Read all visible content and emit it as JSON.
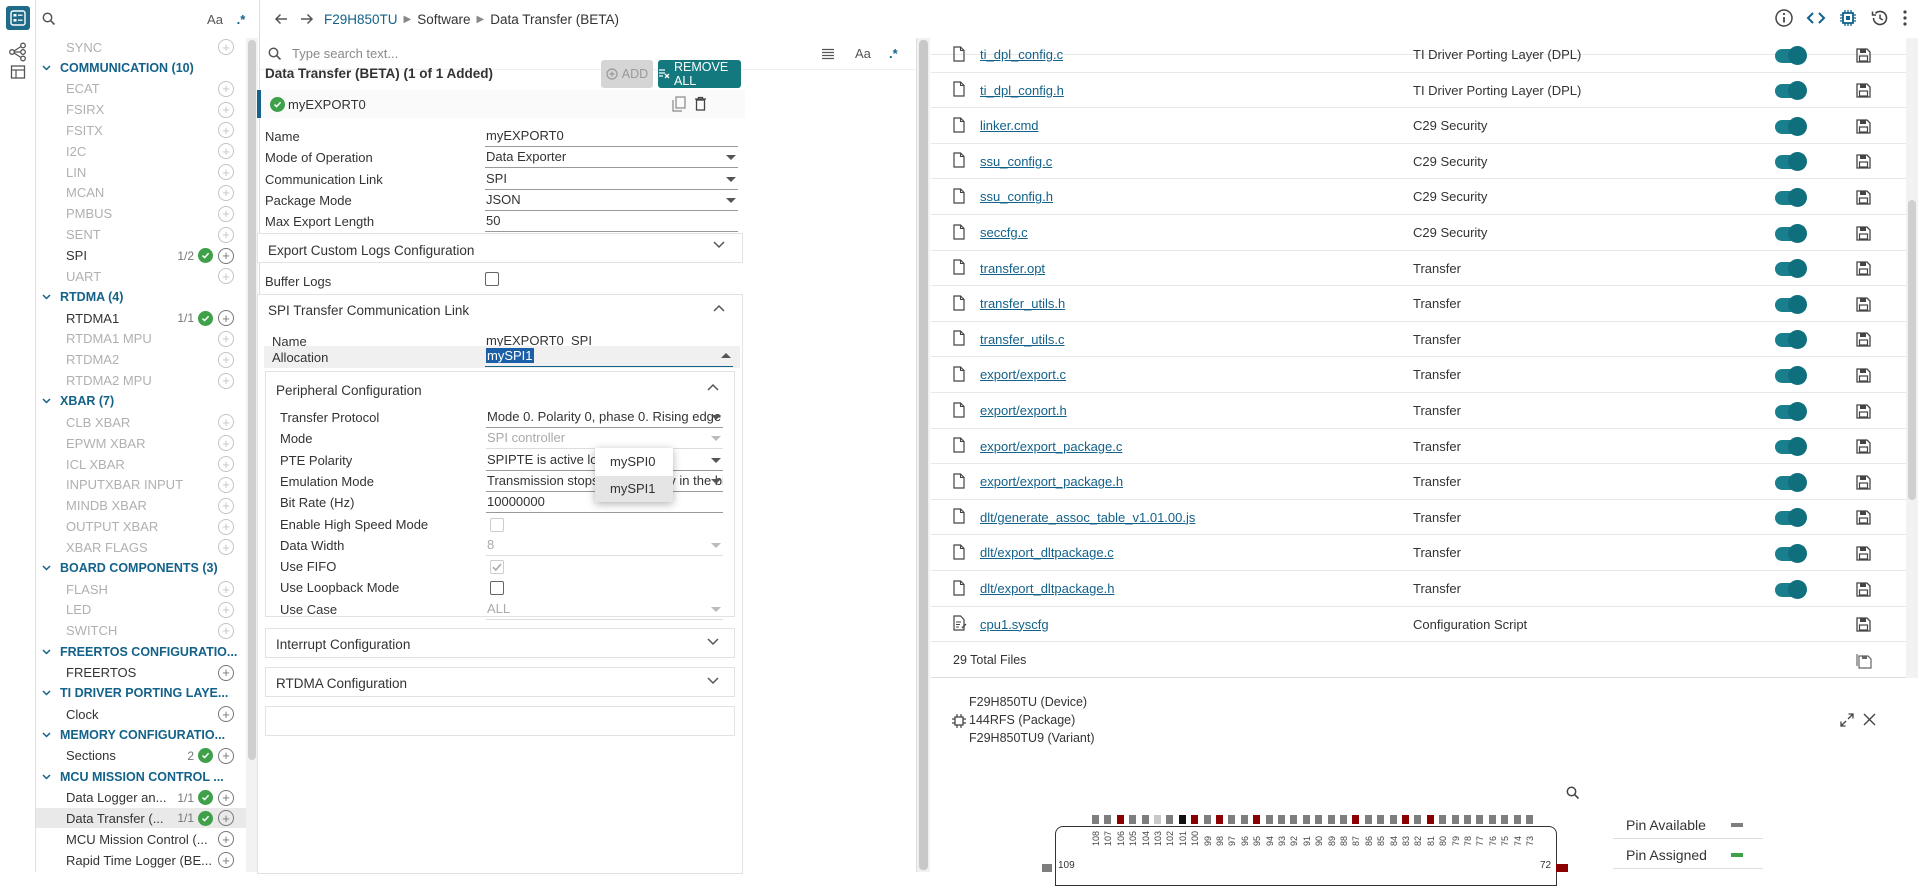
{
  "sidebar": {
    "search_placeholder": "",
    "case_label": "Aa",
    "regex_label": ".*",
    "rows": [
      {
        "kind": "mod",
        "label": "SYNC",
        "count": "",
        "added": false,
        "enabled": false
      },
      {
        "kind": "cat",
        "label": "COMMUNICATION (10)"
      },
      {
        "kind": "mod",
        "label": "ECAT",
        "count": "",
        "added": false,
        "enabled": false
      },
      {
        "kind": "mod",
        "label": "FSIRX",
        "count": "",
        "added": false,
        "enabled": false
      },
      {
        "kind": "mod",
        "label": "FSITX",
        "count": "",
        "added": false,
        "enabled": false
      },
      {
        "kind": "mod",
        "label": "I2C",
        "count": "",
        "added": false,
        "enabled": false
      },
      {
        "kind": "mod",
        "label": "LIN",
        "count": "",
        "added": false,
        "enabled": false
      },
      {
        "kind": "mod",
        "label": "MCAN",
        "count": "",
        "added": false,
        "enabled": false
      },
      {
        "kind": "mod",
        "label": "PMBUS",
        "count": "",
        "added": false,
        "enabled": false
      },
      {
        "kind": "mod",
        "label": "SENT",
        "count": "",
        "added": false,
        "enabled": false
      },
      {
        "kind": "mod",
        "label": "SPI",
        "count": "1/2",
        "added": true,
        "enabled": true
      },
      {
        "kind": "mod",
        "label": "UART",
        "count": "",
        "added": false,
        "enabled": false
      },
      {
        "kind": "cat",
        "label": "RTDMA (4)"
      },
      {
        "kind": "mod",
        "label": "RTDMA1",
        "count": "1/1",
        "added": true,
        "enabled": true
      },
      {
        "kind": "mod",
        "label": "RTDMA1 MPU",
        "count": "",
        "added": false,
        "enabled": false
      },
      {
        "kind": "mod",
        "label": "RTDMA2",
        "count": "",
        "added": false,
        "enabled": false
      },
      {
        "kind": "mod",
        "label": "RTDMA2 MPU",
        "count": "",
        "added": false,
        "enabled": false
      },
      {
        "kind": "cat",
        "label": "XBAR (7)"
      },
      {
        "kind": "mod",
        "label": "CLB XBAR",
        "count": "",
        "added": false,
        "enabled": false
      },
      {
        "kind": "mod",
        "label": "EPWM XBAR",
        "count": "",
        "added": false,
        "enabled": false
      },
      {
        "kind": "mod",
        "label": "ICL XBAR",
        "count": "",
        "added": false,
        "enabled": false
      },
      {
        "kind": "mod",
        "label": "INPUTXBAR INPUT",
        "count": "",
        "added": false,
        "enabled": false
      },
      {
        "kind": "mod",
        "label": "MINDB XBAR",
        "count": "",
        "added": false,
        "enabled": false
      },
      {
        "kind": "mod",
        "label": "OUTPUT XBAR",
        "count": "",
        "added": false,
        "enabled": false
      },
      {
        "kind": "mod",
        "label": "XBAR FLAGS",
        "count": "",
        "added": false,
        "enabled": false
      },
      {
        "kind": "cat",
        "label": "BOARD COMPONENTS (3)"
      },
      {
        "kind": "mod",
        "label": "FLASH",
        "count": "",
        "added": false,
        "enabled": false
      },
      {
        "kind": "mod",
        "label": "LED",
        "count": "",
        "added": false,
        "enabled": false
      },
      {
        "kind": "mod",
        "label": "SWITCH",
        "count": "",
        "added": false,
        "enabled": false
      },
      {
        "kind": "cat",
        "label": "FREERTOS CONFIGURATIO..."
      },
      {
        "kind": "mod",
        "label": "FREERTOS",
        "count": "",
        "added": false,
        "enabled": true
      },
      {
        "kind": "cat",
        "label": "TI DRIVER PORTING LAYE..."
      },
      {
        "kind": "mod",
        "label": "Clock",
        "count": "",
        "added": false,
        "enabled": true
      },
      {
        "kind": "cat",
        "label": "MEMORY CONFIGURATIO..."
      },
      {
        "kind": "mod",
        "label": "Sections",
        "count": "2",
        "added": true,
        "enabled": true
      },
      {
        "kind": "cat",
        "label": "MCU MISSION CONTROL ..."
      },
      {
        "kind": "mod",
        "label": "Data Logger an...",
        "count": "1/1",
        "added": true,
        "enabled": true
      },
      {
        "kind": "mod",
        "label": "Data Transfer (...",
        "count": "1/1",
        "added": true,
        "enabled": true,
        "selected": true
      },
      {
        "kind": "mod",
        "label": "MCU Mission Control (...",
        "count": "",
        "added": false,
        "enabled": true
      },
      {
        "kind": "mod",
        "label": "Rapid Time Logger (BE...",
        "count": "",
        "added": false,
        "enabled": true
      }
    ]
  },
  "breadcrumb": {
    "device": "F29H850TU",
    "section": "Software",
    "page": "Data Transfer (BETA)"
  },
  "config": {
    "search_placeholder": "Type search text...",
    "case_label": "Aa",
    "regex_label": ".*",
    "module_header": "Data Transfer (BETA) (1 of 1 Added)",
    "add_label": "ADD",
    "remove_all_label": "REMOVE ALL",
    "instance_name": "myEXPORT0",
    "fields": [
      {
        "label": "Name",
        "value": "myEXPORT0",
        "dropdown": false
      },
      {
        "label": "Mode of Operation",
        "value": "Data Exporter",
        "dropdown": true
      },
      {
        "label": "Communication Link",
        "value": "SPI",
        "dropdown": true
      },
      {
        "label": "Package Mode",
        "value": "JSON",
        "dropdown": true
      },
      {
        "label": "Max Export Length",
        "value": "50",
        "dropdown": false
      }
    ],
    "export_logs_title": "Export Custom Logs Configuration",
    "buffer_logs_label": "Buffer Logs",
    "spi_link_title": "SPI Transfer Communication Link",
    "spi_name_label": "Name",
    "spi_name_value": "myEXPORT0_SPI",
    "allocation_label": "Allocation",
    "allocation_value": "mySPI1",
    "allocation_options": [
      "mySPI0",
      "mySPI1"
    ],
    "peripheral_title": "Peripheral Configuration",
    "peripheral_fields": [
      {
        "label": "Transfer Protocol",
        "value": "Mode 0. Polarity 0, phase 0. Rising edge ...",
        "type": "select",
        "disabled": false
      },
      {
        "label": "Mode",
        "value": "SPI controller",
        "type": "select",
        "disabled": true
      },
      {
        "label": "PTE Polarity",
        "value": "SPIPTE is active low (normal)",
        "type": "select",
        "disabled": false
      },
      {
        "label": "Emulation Mode",
        "value": "Transmission stops after midway in the bi...",
        "type": "select",
        "disabled": false
      },
      {
        "label": "Bit Rate (Hz)",
        "value": "10000000",
        "type": "text",
        "disabled": false
      },
      {
        "label": "Enable High Speed Mode",
        "value": "",
        "type": "checkbox",
        "checked": false,
        "disabled": true
      },
      {
        "label": "Data Width",
        "value": "8",
        "type": "select",
        "disabled": true
      },
      {
        "label": "Use FIFO",
        "value": "",
        "type": "checkbox",
        "checked": true,
        "disabled": true
      },
      {
        "label": "Use Loopback Mode",
        "value": "",
        "type": "checkbox",
        "checked": false,
        "disabled": false
      },
      {
        "label": "Use Case",
        "value": "ALL",
        "type": "select",
        "disabled": true
      }
    ],
    "interrupt_title": "Interrupt Configuration",
    "rtdma_title": "RTDMA Configuration"
  },
  "files": {
    "rows": [
      {
        "name": "ti_dpl_config.c",
        "component": "TI Driver Porting Layer (DPL)",
        "icon": "file-icon"
      },
      {
        "name": "ti_dpl_config.h",
        "component": "TI Driver Porting Layer (DPL)",
        "icon": "file-icon"
      },
      {
        "name": "linker.cmd",
        "component": "C29 Security",
        "icon": "file-icon"
      },
      {
        "name": "ssu_config.c",
        "component": "C29 Security",
        "icon": "file-icon"
      },
      {
        "name": "ssu_config.h",
        "component": "C29 Security",
        "icon": "file-icon"
      },
      {
        "name": "seccfg.c",
        "component": "C29 Security",
        "icon": "file-icon"
      },
      {
        "name": "transfer.opt",
        "component": "Transfer",
        "icon": "file-icon"
      },
      {
        "name": "transfer_utils.h",
        "component": "Transfer",
        "icon": "file-icon"
      },
      {
        "name": "transfer_utils.c",
        "component": "Transfer",
        "icon": "file-icon"
      },
      {
        "name": "export/export.c",
        "component": "Transfer",
        "icon": "file-icon"
      },
      {
        "name": "export/export.h",
        "component": "Transfer",
        "icon": "file-icon"
      },
      {
        "name": "export/export_package.c",
        "component": "Transfer",
        "icon": "file-icon"
      },
      {
        "name": "export/export_package.h",
        "component": "Transfer",
        "icon": "file-icon"
      },
      {
        "name": "dlt/generate_assoc_table_v1.01.00.js",
        "component": "Transfer",
        "icon": "file-icon"
      },
      {
        "name": "dlt/export_dltpackage.c",
        "component": "Transfer",
        "icon": "file-icon"
      },
      {
        "name": "dlt/export_dltpackage.h",
        "component": "Transfer",
        "icon": "file-icon"
      },
      {
        "name": "cpu1.syscfg",
        "component": "Configuration Script",
        "icon": "script-file-icon"
      }
    ],
    "total": "29 Total Files"
  },
  "device": {
    "device_line": "F29H850TU (Device)",
    "package_line": "144RFS (Package)",
    "variant_line": "F29H850TU9 (Variant)",
    "pin_numbers": [
      "108",
      "107",
      "106",
      "105",
      "104",
      "103",
      "102",
      "101",
      "100",
      "99",
      "98",
      "97",
      "96",
      "95",
      "94",
      "93",
      "92",
      "91",
      "90",
      "89",
      "88",
      "87",
      "86",
      "85",
      "84",
      "83",
      "82",
      "81",
      "80",
      "79",
      "78",
      "77",
      "76",
      "75",
      "74",
      "73"
    ],
    "assigned_pins": [
      "106",
      "100",
      "98",
      "95",
      "87",
      "83",
      "81"
    ],
    "light_pins": [
      "103"
    ],
    "black_pins": [
      "101"
    ],
    "corner_left": "109",
    "corner_right": "72",
    "legend": [
      {
        "label": "Pin Available",
        "color": "#7e7e7e"
      },
      {
        "label": "Pin Assigned",
        "color": "#3fa04a"
      }
    ]
  }
}
